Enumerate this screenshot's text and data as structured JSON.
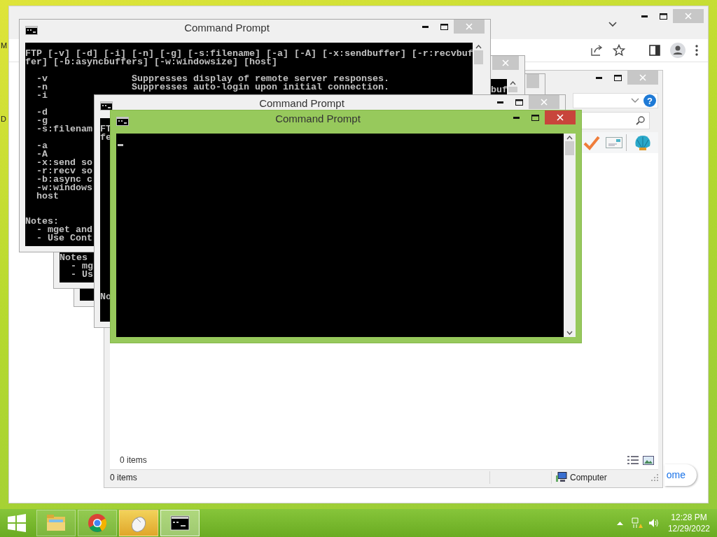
{
  "desktop": {
    "labels": [
      "M",
      "D"
    ]
  },
  "browser": {
    "home_button": "ome"
  },
  "explorer": {
    "help_glyph": "?",
    "details": "0 items",
    "status_items": "0 items",
    "status_location": "Computer"
  },
  "consoles": [
    {
      "active": false
    },
    {
      "active": false,
      "lines": [
        "buf",
        "Notes",
        "- mg",
        "- Us"
      ]
    },
    {
      "title": "Command Prompt",
      "active": false,
      "lines": [
        "FTP [-v] [-d] [-i] [-n] [-g] [-s:filename] [-a] [-A] [-x:sendbuffer] [-r:recvbuf",
        "fer] [-b:asyncbuffers] [-w:windowsize] [host]",
        "-v               Suppresses display of remote server responses.",
        "-n               Suppresses auto-login upon initial connection.",
        "-i",
        "-d",
        "-g",
        "-s:filenam",
        "-a",
        "-A",
        "-x:send so",
        "-r:recv so",
        "-b:async c",
        "-w:windows",
        "host",
        "Notes:",
        "- mget and",
        "- Use Cont"
      ]
    },
    {
      "title": "Command Prompt",
      "active": false,
      "lines": [
        "FT",
        "fe",
        "No"
      ]
    },
    {
      "title": "Command Prompt",
      "active": true
    }
  ],
  "taskbar": {
    "buttons": [
      {
        "kind": "files",
        "selected": false
      },
      {
        "kind": "browser",
        "selected": false
      },
      {
        "kind": "mouse",
        "selected": false
      },
      {
        "kind": "console",
        "selected": true
      }
    ],
    "clock": {
      "time": "12:28 PM",
      "date": "12/29/2022"
    }
  }
}
